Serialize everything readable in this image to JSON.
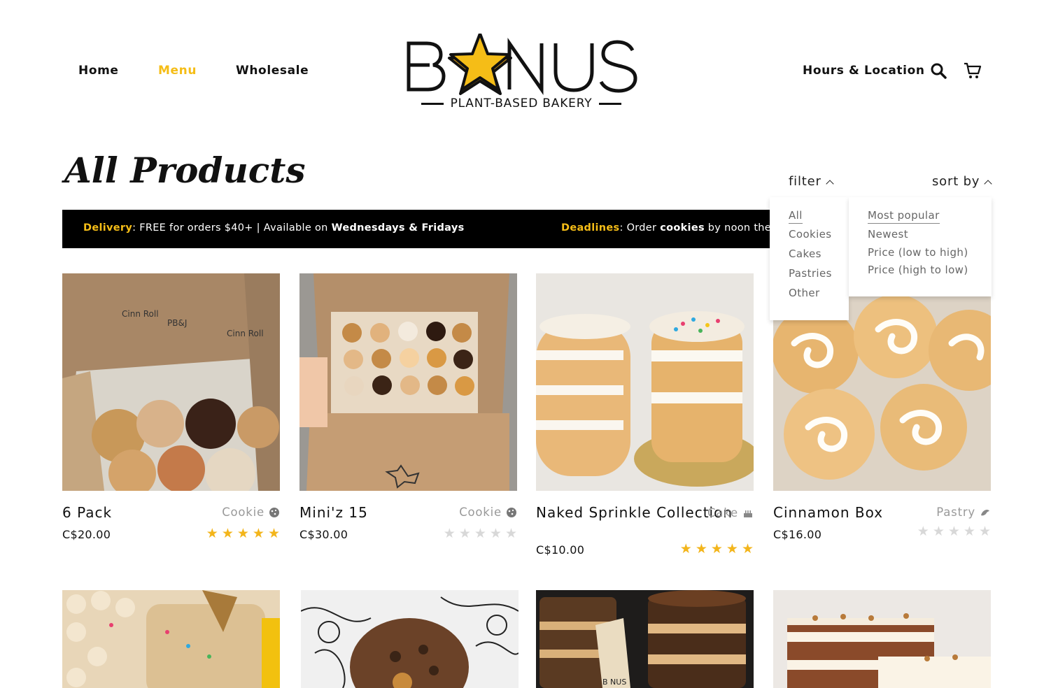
{
  "nav": {
    "home": "Home",
    "menu": "Menu",
    "wholesale": "Wholesale",
    "hours": "Hours & Location"
  },
  "logo": {
    "word_left": "B",
    "word_right": "NUS",
    "tagline": "PLANT-BASED BAKERY"
  },
  "page": {
    "title": "All Products",
    "filter_label": "filter",
    "sort_label": "sort by"
  },
  "banner": {
    "delivery_label": "Delivery",
    "delivery_text1": ": FREE for orders $40+ | Available on ",
    "delivery_days": "Wednesdays & Fridays",
    "deadline_label": "Deadlines",
    "deadline_text1": ": Order ",
    "deadline_cookies": "cookies",
    "deadline_text2": " by noon the da"
  },
  "filter_options": [
    "All",
    "Cookies",
    "Cakes",
    "Pastries",
    "Other"
  ],
  "sort_options": [
    "Most popular",
    "Newest",
    "Price (low to high)",
    "Price (high to low)"
  ],
  "products": [
    {
      "name": "6 Pack",
      "price": "C$20.00",
      "category": "Cookie",
      "icon": "cookie-icon",
      "rating": 5
    },
    {
      "name": "Mini'z 15",
      "price": "C$30.00",
      "category": "Cookie",
      "icon": "cookie-icon",
      "rating": 0
    },
    {
      "name": "Naked Sprinkle Collection",
      "price": "C$10.00",
      "category": "Cake",
      "icon": "cake-icon",
      "rating": 5
    },
    {
      "name": "Cinnamon Box",
      "price": "C$16.00",
      "category": "Pastry",
      "icon": "croissant-icon",
      "rating": 0
    }
  ],
  "colors": {
    "accent": "#f5bd17",
    "star_on": "#f3b51b",
    "star_off": "#d8d8d8",
    "banner_bg": "#000000"
  }
}
